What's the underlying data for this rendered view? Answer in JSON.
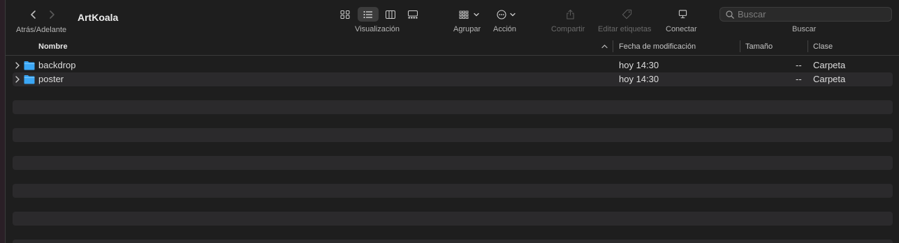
{
  "window": {
    "title": "ArtKoala"
  },
  "toolbar": {
    "nav_label": "Atrás/Adelante",
    "view_label": "Visualización",
    "group_label": "Agrupar",
    "action_label": "Acción",
    "share_label": "Compartir",
    "tags_label": "Editar etiquetas",
    "connect_label": "Conectar",
    "search_label": "Buscar",
    "search_placeholder": "Buscar",
    "icons": {
      "back": "chevron-left-icon",
      "forward": "chevron-right-icon",
      "view_icons": "grid-icon",
      "view_list": "list-icon",
      "view_columns": "columns-icon",
      "view_gallery": "gallery-icon",
      "group": "group-icon",
      "action": "ellipsis-circle-icon",
      "share": "share-icon",
      "tags": "tag-icon",
      "connect": "monitor-icon",
      "search": "magnifier-icon"
    }
  },
  "columns": {
    "name": "Nombre",
    "modified": "Fecha de modificación",
    "size": "Tamaño",
    "kind": "Clase"
  },
  "rows": [
    {
      "name": "backdrop",
      "modified": "hoy 14:30",
      "size": "--",
      "kind": "Carpeta"
    },
    {
      "name": "poster",
      "modified": "hoy 14:30",
      "size": "--",
      "kind": "Carpeta"
    }
  ],
  "colors": {
    "background": "#1e1e1e",
    "stripe": "#2b2a2c",
    "folder": "#3ba7f5",
    "active_view": "#3c3c3c"
  }
}
